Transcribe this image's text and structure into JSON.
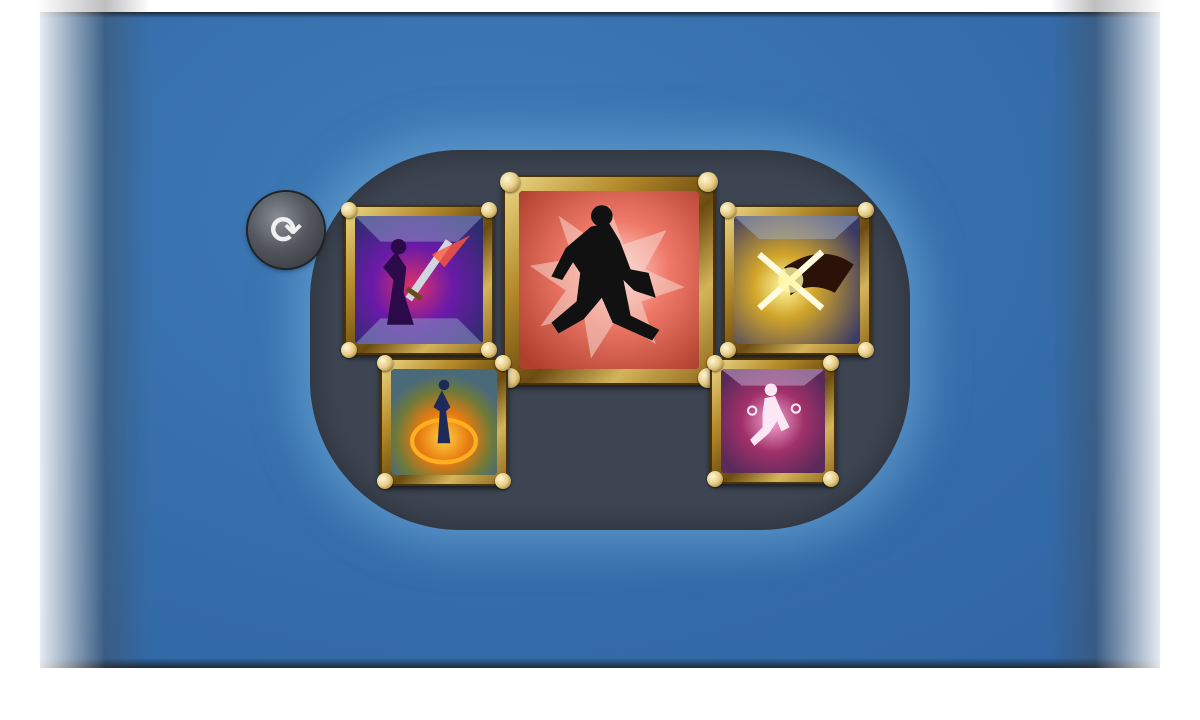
{
  "screen": {
    "name": "skill-selection",
    "refresh_icon": "refresh-icon",
    "refresh_glyph": "⟳"
  },
  "skills": [
    {
      "slot": "top-left",
      "icon": "sword-strike-icon",
      "theme": "purple-red"
    },
    {
      "slot": "center-large",
      "icon": "sprint-dash-icon",
      "theme": "red-orange",
      "selected": true
    },
    {
      "slot": "top-right",
      "icon": "lightning-slash-icon",
      "theme": "yellow-dark"
    },
    {
      "slot": "bottom-left",
      "icon": "fire-aura-icon",
      "theme": "orange-teal"
    },
    {
      "slot": "bottom-right",
      "icon": "evade-icon",
      "theme": "pink-magenta"
    }
  ],
  "colors": {
    "background_blue": "#3770ad",
    "tray": "#3d4552",
    "frame_gold": "#b48a2a"
  }
}
